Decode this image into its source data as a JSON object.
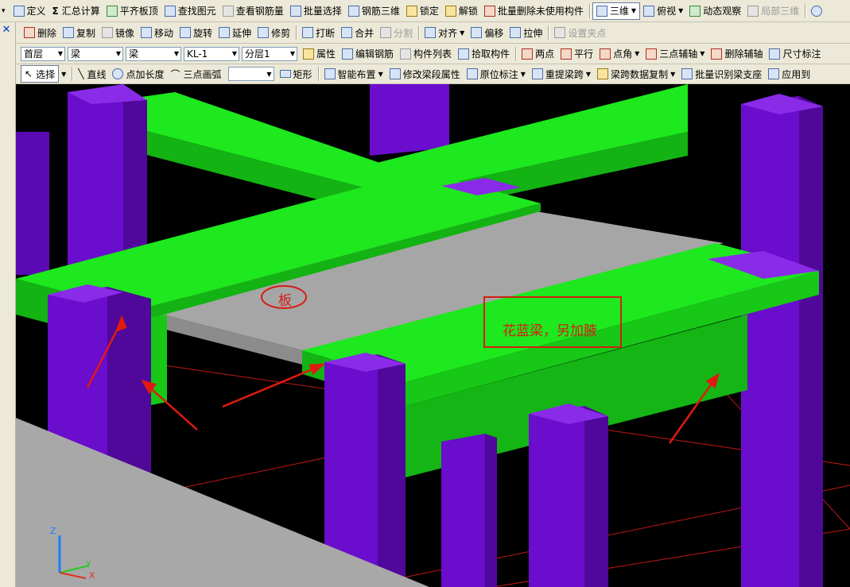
{
  "toolbar1": {
    "items": [
      {
        "label": "定义",
        "icon": "define-icon"
      },
      {
        "label": "汇总计算",
        "icon": "sigma-icon",
        "glyph": "Σ"
      },
      {
        "label": "平齐板顶",
        "icon": "align-slab-top-icon"
      },
      {
        "label": "查找图元",
        "icon": "binoculars-icon"
      },
      {
        "label": "查看钢筋量",
        "icon": "view-rebar-icon"
      },
      {
        "label": "批量选择",
        "icon": "batch-select-icon"
      },
      {
        "label": "钢筋三维",
        "icon": "rebar-3d-icon"
      },
      {
        "label": "锁定",
        "icon": "lock-icon"
      },
      {
        "label": "解锁",
        "icon": "unlock-icon"
      },
      {
        "label": "批量删除未使用构件",
        "icon": "batch-delete-icon"
      },
      {
        "label": "三维",
        "icon": "cube-3d-icon",
        "dropdown": true
      },
      {
        "label": "俯视",
        "icon": "top-view-icon",
        "dropdown": true
      },
      {
        "label": "动态观察",
        "icon": "orbit-icon"
      },
      {
        "label": "局部三维",
        "icon": "local-3d-icon",
        "disabled": true
      }
    ]
  },
  "toolbar2": {
    "items": [
      {
        "label": "删除",
        "icon": "delete-icon"
      },
      {
        "label": "复制",
        "icon": "copy-icon"
      },
      {
        "label": "镜像",
        "icon": "mirror-icon"
      },
      {
        "label": "移动",
        "icon": "move-icon"
      },
      {
        "label": "旋转",
        "icon": "rotate-icon"
      },
      {
        "label": "延伸",
        "icon": "extend-icon"
      },
      {
        "label": "修剪",
        "icon": "trim-icon"
      },
      {
        "label": "打断",
        "icon": "break-icon"
      },
      {
        "label": "合并",
        "icon": "merge-icon"
      },
      {
        "label": "分割",
        "icon": "split-icon",
        "disabled": true
      },
      {
        "label": "对齐",
        "icon": "align-icon",
        "dropdown": true
      },
      {
        "label": "偏移",
        "icon": "offset-icon"
      },
      {
        "label": "拉伸",
        "icon": "stretch-icon"
      },
      {
        "label": "设置夹点",
        "icon": "grip-icon",
        "disabled": true
      }
    ]
  },
  "toolbar3": {
    "selects": {
      "floor": "首层",
      "category": "梁",
      "type": "梁",
      "component": "KL-1",
      "layer": "分层1"
    },
    "items": [
      {
        "label": "属性",
        "icon": "properties-icon"
      },
      {
        "label": "编辑钢筋",
        "icon": "edit-rebar-icon"
      },
      {
        "label": "构件列表",
        "icon": "component-list-icon"
      },
      {
        "label": "拾取构件",
        "icon": "pick-component-icon"
      },
      {
        "label": "两点",
        "icon": "two-point-icon"
      },
      {
        "label": "平行",
        "icon": "parallel-icon"
      },
      {
        "label": "点角",
        "icon": "point-angle-icon",
        "dropdown": true
      },
      {
        "label": "三点辅轴",
        "icon": "three-point-axis-icon",
        "dropdown": true
      },
      {
        "label": "删除辅轴",
        "icon": "delete-axis-icon"
      },
      {
        "label": "尺寸标注",
        "icon": "dimension-icon"
      }
    ]
  },
  "toolbar4": {
    "select_label": "选择",
    "items": [
      {
        "label": "直线",
        "icon": "line-icon"
      },
      {
        "label": "点加长度",
        "icon": "point-length-icon"
      },
      {
        "label": "三点画弧",
        "icon": "arc-icon"
      }
    ],
    "items2": [
      {
        "label": "矩形",
        "icon": "rectangle-icon"
      },
      {
        "label": "智能布置",
        "icon": "smart-layout-icon",
        "dropdown": true
      },
      {
        "label": "修改梁段属性",
        "icon": "beam-segment-icon"
      },
      {
        "label": "原位标注",
        "icon": "in-situ-label-icon",
        "dropdown": true
      },
      {
        "label": "重提梁跨",
        "icon": "beam-span-icon",
        "dropdown": true
      },
      {
        "label": "梁跨数据复制",
        "icon": "span-copy-icon",
        "dropdown": true
      },
      {
        "label": "批量识别梁支座",
        "icon": "beam-support-icon"
      },
      {
        "label": "应用到",
        "icon": "apply-to-icon"
      }
    ]
  },
  "viewport": {
    "annotation_slab": "板",
    "annotation_note": "花蓝梁，另加腋",
    "axis": {
      "z": "Z",
      "y": "Y",
      "x": "X"
    },
    "colors": {
      "beam": "#1EE81E",
      "beam_dark": "#13B313",
      "column": "#6A0DCC",
      "column_dark": "#4F0899",
      "column_top": "#8A2BE8",
      "slab": "#A6A6A6",
      "annotation": "#D41E14",
      "grid": "#C01818"
    }
  }
}
